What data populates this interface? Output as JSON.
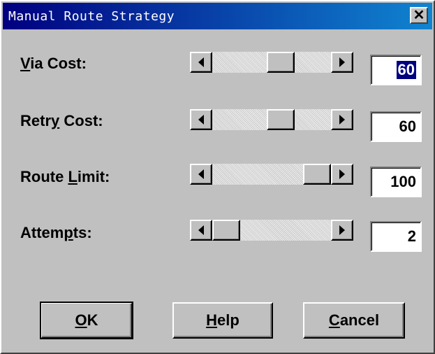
{
  "window": {
    "title": "Manual Route Strategy",
    "close_glyph": "✕"
  },
  "fields": [
    {
      "label_pre": "",
      "label_accel": "V",
      "label_post": "ia Cost:",
      "value": "60",
      "position_fraction": 0.6,
      "selected": true
    },
    {
      "label_pre": "Retr",
      "label_accel": "y",
      "label_post": " Cost:",
      "value": "60",
      "position_fraction": 0.6,
      "selected": false
    },
    {
      "label_pre": "Route ",
      "label_accel": "L",
      "label_post": "imit:",
      "value": "100",
      "position_fraction": 1.0,
      "selected": false
    },
    {
      "label_pre": "Attem",
      "label_accel": "p",
      "label_post": "ts:",
      "value": "2",
      "position_fraction": 0.0,
      "selected": false
    }
  ],
  "buttons": {
    "ok": {
      "accel": "O",
      "rest": "K"
    },
    "help": {
      "accel": "H",
      "rest": "elp"
    },
    "cancel": {
      "accel": "C",
      "rest": "ancel"
    }
  }
}
